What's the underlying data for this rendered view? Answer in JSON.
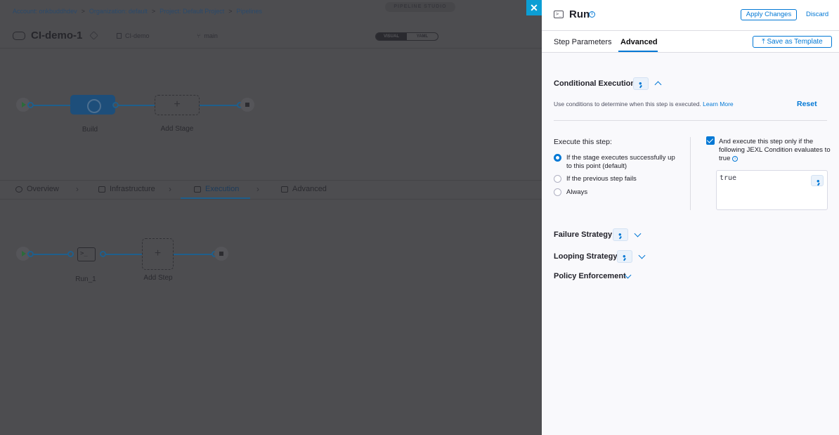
{
  "breadcrumbs": [
    "Account: onkbuddhdev",
    "Organization: default",
    "Project: Default Project",
    "Pipelines"
  ],
  "studio_badge": "PIPELINE STUDIO",
  "pipeline": {
    "name": "CI-demo-1",
    "repo": "CI-demo",
    "branch": "main"
  },
  "view_toggle": {
    "visual": "VISUAL",
    "yaml": "YAML",
    "active": "visual"
  },
  "stages": {
    "build_label": "Build",
    "add_stage_label": "Add Stage"
  },
  "stage_tabs": [
    {
      "label": "Overview",
      "icon": "overview-icon"
    },
    {
      "label": "Infrastructure",
      "icon": "infrastructure-icon"
    },
    {
      "label": "Execution",
      "icon": "execution-icon",
      "active": true
    },
    {
      "label": "Advanced",
      "icon": "advanced-icon"
    }
  ],
  "steps": {
    "run_label": "Run_1",
    "add_step_label": "Add Step"
  },
  "drawer": {
    "title": "Run",
    "apply_label": "Apply Changes",
    "discard_label": "Discard",
    "tabs": [
      "Step Parameters",
      "Advanced"
    ],
    "active_tab": "Advanced",
    "save_template_label": "Save as Template",
    "conditional": {
      "title": "Conditional Execution",
      "description": "Use conditions to determine when this step is executed.",
      "learn_more": "Learn More",
      "reset": "Reset",
      "execute_label": "Execute this step:",
      "options": [
        "If the stage executes successfully up to this point (default)",
        "If the previous step fails",
        "Always"
      ],
      "selected_option": 0,
      "jexl_checked": true,
      "jexl_label": "And execute this step only if the following JEXL Condition evaluates to true",
      "jexl_value": "true"
    },
    "sections": [
      "Failure Strategy",
      "Looping Strategy",
      "Policy Enforcement"
    ]
  },
  "colors": {
    "accent": "#0278d5",
    "close_button": "#0c9ed4"
  }
}
